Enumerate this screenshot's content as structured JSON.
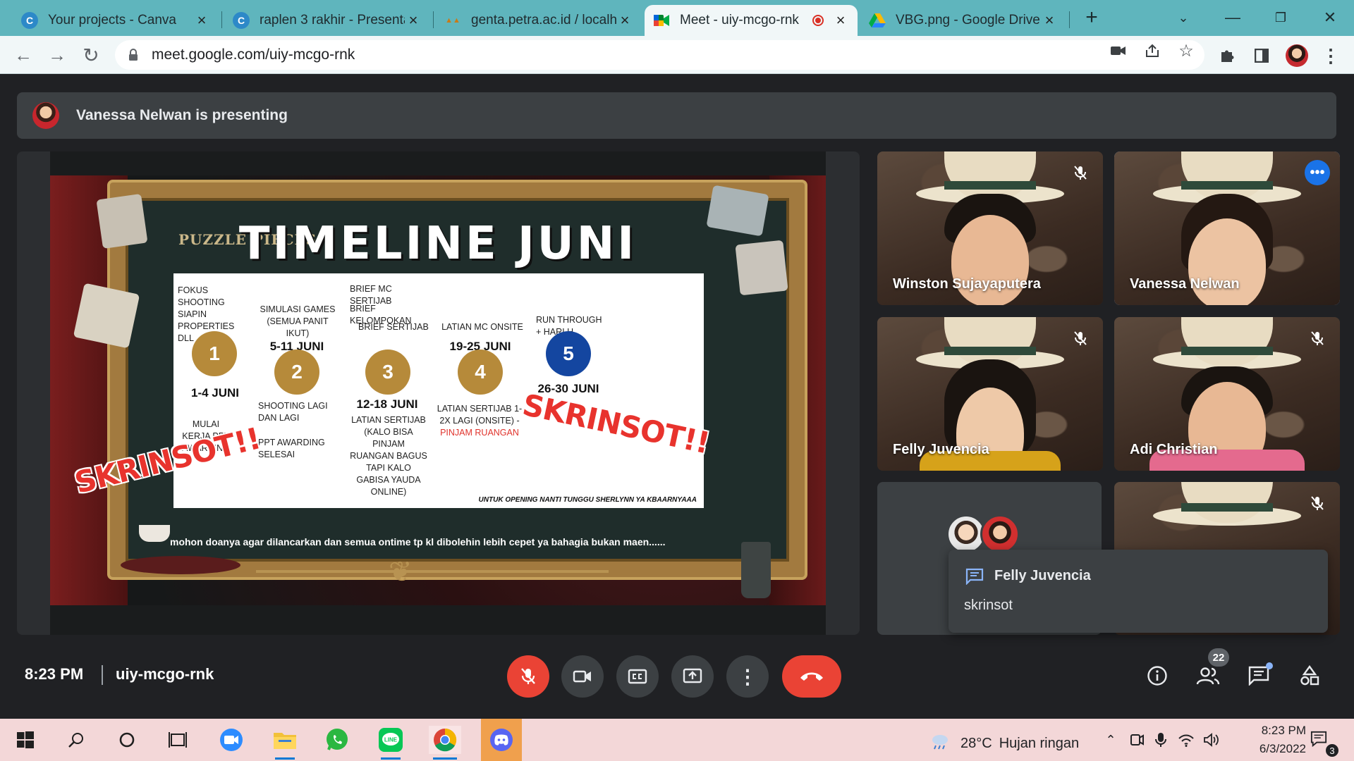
{
  "browser": {
    "tabs": [
      {
        "title": "Your projects - Canva",
        "favicon": "canva-icon"
      },
      {
        "title": "raplen 3 rakhir - Presentat",
        "favicon": "canva-icon"
      },
      {
        "title": "genta.petra.ac.id / localhc",
        "favicon": "phpmyadmin-icon"
      },
      {
        "title": "Meet - uiy-mcgo-rnk",
        "favicon": "meet-icon"
      },
      {
        "title": "VBG.png - Google Drive",
        "favicon": "drive-icon"
      }
    ],
    "url": "meet.google.com/uiy-mcgo-rnk"
  },
  "meet": {
    "presenting": "Vanessa Nelwan is presenting",
    "time": "8:23 PM",
    "code": "uiy-mcgo-rnk",
    "participant_count": "22",
    "participants": [
      {
        "name": "Winston Sujayaputera"
      },
      {
        "name": "Vanessa Nelwan"
      },
      {
        "name": "Felly Juvencia"
      },
      {
        "name": "Adi Christian"
      }
    ],
    "chat_toast": {
      "sender": "Felly Juvencia",
      "message": "skrinsot"
    }
  },
  "slide": {
    "brand": "PUZZLE PIECES",
    "title": "TIMELINE JUNI",
    "steps": [
      {
        "num": "1",
        "date": "1-4 JUNI",
        "top": "FOKUS SHOOTING SIAPIN PROPERTIES DLL",
        "bottom": "MULAI KERJA PPT AWARDING",
        "color": "#b68a3a"
      },
      {
        "num": "2",
        "date": "5-11 JUNI",
        "top": "SIMULASI GAMES (SEMUA PANIT IKUT)",
        "bottom1": "SHOOTING LAGI DAN LAGI",
        "bottom2": "PPT AWARDING SELESAI",
        "color": "#b68a3a"
      },
      {
        "num": "3",
        "date": "12-18 JUNI",
        "top1": "BRIEF MC SERTIJAB",
        "top2": "BRIEF KELOMPOKAN",
        "top3": "BRIEF SERTIJAB",
        "bottom": "LATIAN SERTIJAB (KALO BISA PINJAM RUANGAN BAGUS TAPI KALO GABISA YAUDA ONLINE)",
        "color": "#b68a3a"
      },
      {
        "num": "4",
        "date": "19-25 JUNI",
        "top": "LATIAN MC ONSITE",
        "bottom": "LATIAN SERTIJAB 1-2X LAGI (ONSITE) -",
        "bottom_red": "PINJAM RUANGAN",
        "color": "#b68a3a"
      },
      {
        "num": "5",
        "date": "26-30 JUNI",
        "top": "RUN THROUGH + HARI H",
        "bottom": "",
        "color": "#1446a0"
      }
    ],
    "footnote": "UNTUK OPENING NANTI TUNGGU SHERLYNN YA KBAARNYAAA",
    "caption": "mohon doanya agar dilancarkan dan semua ontime tp kl dibolehin lebih cepet ya bahagia bukan maen......",
    "sticker": "SKRINSOT!!"
  },
  "taskbar": {
    "weather_temp": "28°C",
    "weather_text": "Hujan ringan",
    "clock_time": "8:23 PM",
    "clock_date": "6/3/2022",
    "notifications": "3"
  },
  "colors": {
    "tabstrip": "#5fb5bd",
    "meet_bg": "#202124",
    "accent_red": "#ea4335",
    "accent_blue": "#1a73e8"
  }
}
